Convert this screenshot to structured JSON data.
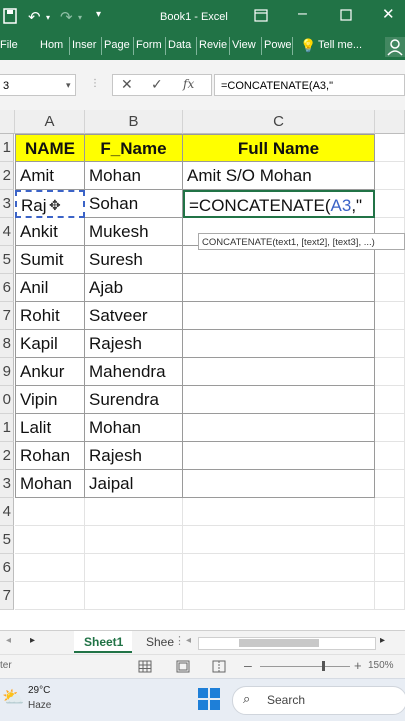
{
  "titlebar": {
    "title": "Book1 - Excel",
    "autosave_icon": "save-icon",
    "accent": "#217346"
  },
  "ribbon": {
    "tabs": [
      "File",
      "Hom",
      "Inser",
      "Page",
      "Form",
      "Data",
      "Revie",
      "View",
      "Powe"
    ],
    "tell_me": "Tell me..."
  },
  "formula_bar": {
    "name_box": "3",
    "formula": "=CONCATENATE(A3,\""
  },
  "grid": {
    "columns": [
      "A",
      "B",
      "C"
    ],
    "row_numbers": [
      "1",
      "2",
      "3",
      "4",
      "5",
      "6",
      "7",
      "8",
      "9",
      "0",
      "1",
      "2",
      "3",
      "4",
      "5",
      "6",
      "7"
    ],
    "header_row": [
      "NAME",
      "F_Name",
      "Full Name"
    ],
    "rows": [
      [
        "Amit",
        "Mohan",
        "Amit S/O Mohan"
      ],
      [
        "Raj",
        "Sohan",
        ""
      ],
      [
        "Ankit",
        "Mukesh",
        ""
      ],
      [
        "Sumit",
        "Suresh",
        ""
      ],
      [
        "Anil",
        "Ajab",
        ""
      ],
      [
        "Rohit",
        "Satveer",
        ""
      ],
      [
        "Kapil",
        "Rajesh",
        ""
      ],
      [
        "Ankur",
        "Mahendra",
        ""
      ],
      [
        "Vipin",
        "Surendra",
        ""
      ],
      [
        "Lalit",
        "Mohan",
        ""
      ],
      [
        "Rohan",
        "Rajesh",
        ""
      ],
      [
        "Mohan",
        "Jaipal",
        ""
      ]
    ],
    "editing_prefix": "=CONCATENATE(",
    "editing_ref": "A3",
    "editing_suffix": ",\"",
    "tooltip": "CONCATENATE(text1, [text2], [text3], ...)",
    "header_fill": "#ffff00"
  },
  "sheets": {
    "active": "Sheet1",
    "other": "Shee"
  },
  "status": {
    "left": "ter",
    "zoom": "150%"
  },
  "taskbar": {
    "temperature": "29°C",
    "weather": "Haze",
    "search": "Search"
  }
}
